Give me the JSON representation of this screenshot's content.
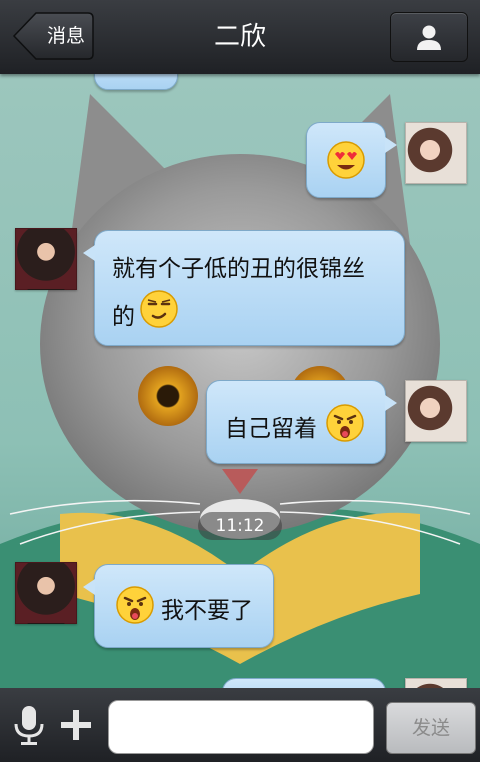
{
  "header": {
    "back_label": "消息",
    "title": "二欣",
    "profile_icon": "user-icon"
  },
  "messages": [
    {
      "side": "right",
      "text": "",
      "emoji": "heart-eyes-emoji"
    },
    {
      "side": "left",
      "text_line1": "就有个子低的丑的很锦丝",
      "text_line2": "的",
      "emoji": "smirk-emoji"
    },
    {
      "side": "right",
      "text": "自己留着",
      "emoji": "drooling-emoji"
    },
    {
      "time": "11:12"
    },
    {
      "side": "left",
      "text": "我不要了",
      "emoji": "drooling-emoji"
    }
  ],
  "bottom_bar": {
    "input_value": "",
    "send_label": "发送",
    "mic_icon": "microphone-icon",
    "plus_icon": "plus-icon"
  },
  "colors": {
    "bubble_top": "#cfe7fa",
    "bubble_bottom": "#a9d2f2",
    "bar_bg": "#2b2d31"
  }
}
